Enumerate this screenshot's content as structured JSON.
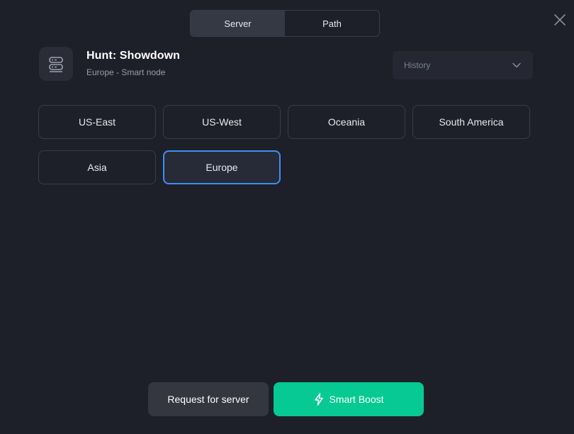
{
  "tabs": [
    {
      "label": "Server",
      "active": true
    },
    {
      "label": "Path",
      "active": false
    }
  ],
  "close_icon": "close-icon",
  "game": {
    "icon": "server-icon",
    "title": "Hunt: Showdown",
    "subtitle": "Europe - Smart node"
  },
  "history": {
    "label": "History",
    "icon": "chevron-down-icon"
  },
  "regions": [
    {
      "label": "US-East",
      "selected": false
    },
    {
      "label": "US-West",
      "selected": false
    },
    {
      "label": "Oceania",
      "selected": false
    },
    {
      "label": "South America",
      "selected": false
    },
    {
      "label": "Asia",
      "selected": false
    },
    {
      "label": "Europe",
      "selected": true
    }
  ],
  "actions": {
    "request_label": "Request for server",
    "boost_label": "Smart Boost",
    "boost_icon": "lightning-icon"
  },
  "colors": {
    "background": "#1d1f29",
    "accent_green": "#06c994",
    "selected_border": "#3f8ef3"
  }
}
